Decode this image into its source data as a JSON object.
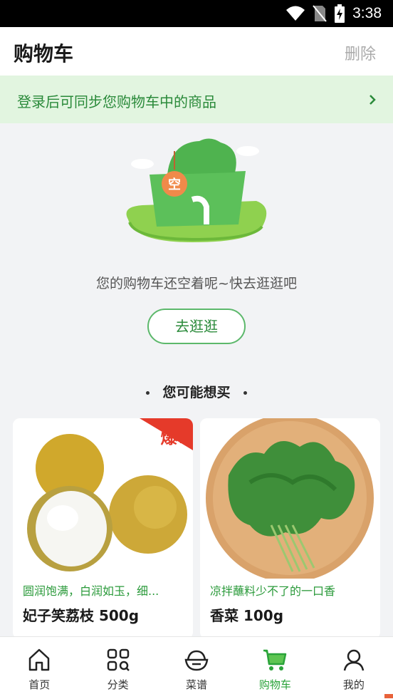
{
  "status_bar": {
    "time": "3:38",
    "icons": [
      "wifi-icon",
      "no-sim-icon",
      "battery-charging-icon"
    ]
  },
  "header": {
    "title": "购物车",
    "delete_label": "删除"
  },
  "login_banner": {
    "text": "登录后可同步您购物车中的商品",
    "icon": "chevron-right-icon"
  },
  "empty_state": {
    "tag_char": "空",
    "message": "您的购物车还空着呢~快去逛逛吧",
    "button_label": "去逛逛"
  },
  "recommend": {
    "title": "您可能想买",
    "products": [
      {
        "badge": "爆!",
        "slogan": "圆润饱满，白润如玉，细...",
        "name": "妃子笑荔枝 500g"
      },
      {
        "slogan": "凉拌蘸料少不了的一口香",
        "name": "香菜 100g"
      }
    ]
  },
  "tabbar": {
    "tabs": [
      {
        "label": "首页",
        "icon": "home-icon"
      },
      {
        "label": "分类",
        "icon": "category-icon"
      },
      {
        "label": "菜谱",
        "icon": "recipe-bowl-icon"
      },
      {
        "label": "购物车",
        "icon": "cart-icon",
        "active": true
      },
      {
        "label": "我的",
        "icon": "user-icon"
      }
    ]
  },
  "colors": {
    "accent": "#2aa33a",
    "banner_bg": "#e2f5e0",
    "badge_red": "#e53a2a"
  }
}
